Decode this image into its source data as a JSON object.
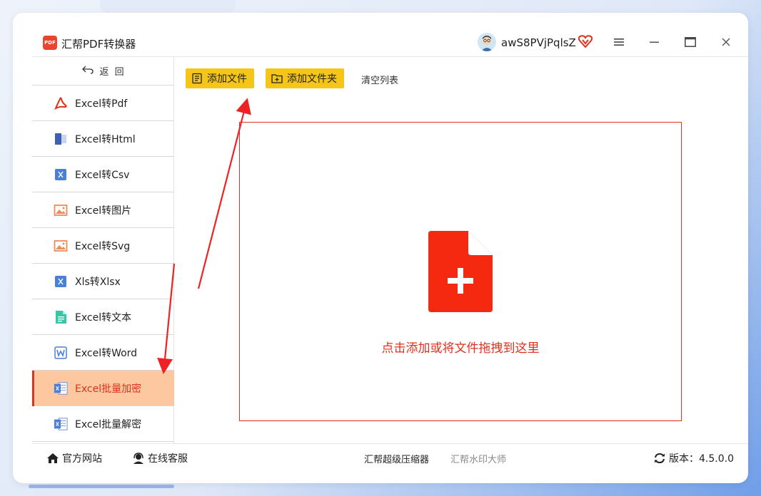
{
  "app": {
    "title": "汇帮PDF转换器",
    "logo_text": "PDF",
    "username": "awS8PVjPqlsZ"
  },
  "sidebar": {
    "back_label": "返  回",
    "items": [
      {
        "label": "Excel转Pdf",
        "icon": "pdf-icon"
      },
      {
        "label": "Excel转Html",
        "icon": "html-icon"
      },
      {
        "label": "Excel转Csv",
        "icon": "csv-icon"
      },
      {
        "label": "Excel转图片",
        "icon": "image-icon"
      },
      {
        "label": "Excel转Svg",
        "icon": "svg-icon"
      },
      {
        "label": "Xls转Xlsx",
        "icon": "xlsx-icon"
      },
      {
        "label": "Excel转文本",
        "icon": "text-icon"
      },
      {
        "label": "Excel转Word",
        "icon": "word-icon"
      },
      {
        "label": "Excel批量加密",
        "icon": "encrypt-icon",
        "active": true
      },
      {
        "label": "Excel批量解密",
        "icon": "decrypt-icon"
      }
    ]
  },
  "toolbar": {
    "add_file": "添加文件",
    "add_folder": "添加文件夹",
    "clear_list": "清空列表"
  },
  "dropzone": {
    "text": "点击添加或将文件拖拽到这里"
  },
  "footer": {
    "website": "官方网站",
    "support": "在线客服",
    "compressor": "汇帮超级压缩器",
    "watermark": "汇帮水印大师",
    "version": "版本：4.5.0.0"
  },
  "colors": {
    "accent": "#e0301e",
    "button": "#f5c518",
    "active_bg": "#fdc89f"
  }
}
